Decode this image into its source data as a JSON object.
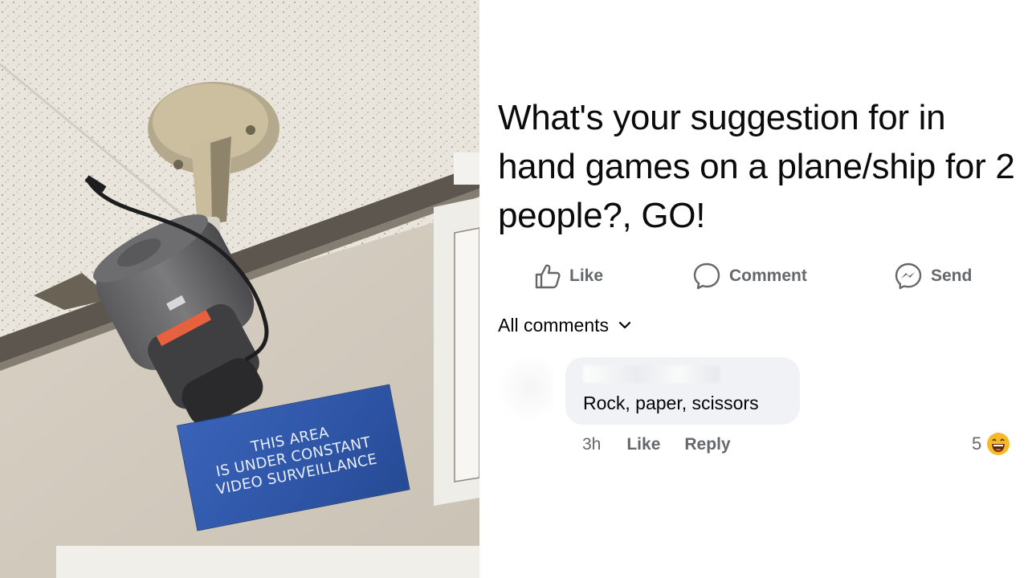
{
  "photo": {
    "sign_lines": [
      "THIS AREA",
      "IS UNDER CONSTANT",
      "VIDEO SURVEILLANCE"
    ]
  },
  "post": {
    "question": "What's your suggestion for in hand games on a plane/ship for 2 people?, GO!",
    "actions": {
      "like_label": "Like",
      "comment_label": "Comment",
      "send_label": "Send"
    },
    "all_comments_label": "All comments",
    "comment": {
      "text": "Rock, paper, scissors",
      "time": "3h",
      "like_label": "Like",
      "reply_label": "Reply",
      "reaction_count": "5",
      "reaction_icon": "laughing-emoji-icon"
    },
    "colors": {
      "action_text": "#65676b",
      "bubble_bg": "#f0f2f5",
      "sign_blue": "#2e55a6"
    }
  }
}
